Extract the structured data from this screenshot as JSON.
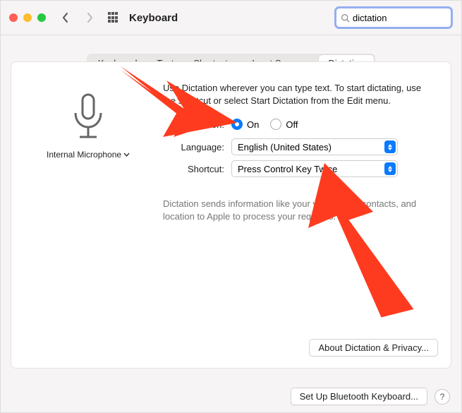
{
  "titlebar": {
    "title": "Keyboard",
    "search_value": "dictation"
  },
  "tabs": [
    {
      "label": "Keyboard",
      "active": false
    },
    {
      "label": "Text",
      "active": false
    },
    {
      "label": "Shortcuts",
      "active": false
    },
    {
      "label": "Input Sources",
      "active": false
    },
    {
      "label": "Dictation",
      "active": true
    }
  ],
  "mic": {
    "label": "Internal Microphone"
  },
  "description": "Use Dictation wherever you can type text. To start dictating, use the shortcut or select Start Dictation from the Edit menu.",
  "form": {
    "dictation": {
      "label": "Dictation:",
      "on": "On",
      "off": "Off",
      "value": "On"
    },
    "language": {
      "label": "Language:",
      "value": "English (United States)"
    },
    "shortcut": {
      "label": "Shortcut:",
      "value": "Press Control Key Twice"
    }
  },
  "footnote": "Dictation sends information like your voice input, contacts, and location to Apple to process your requests.",
  "buttons": {
    "about": "About Dictation & Privacy...",
    "setup": "Set Up Bluetooth Keyboard..."
  }
}
